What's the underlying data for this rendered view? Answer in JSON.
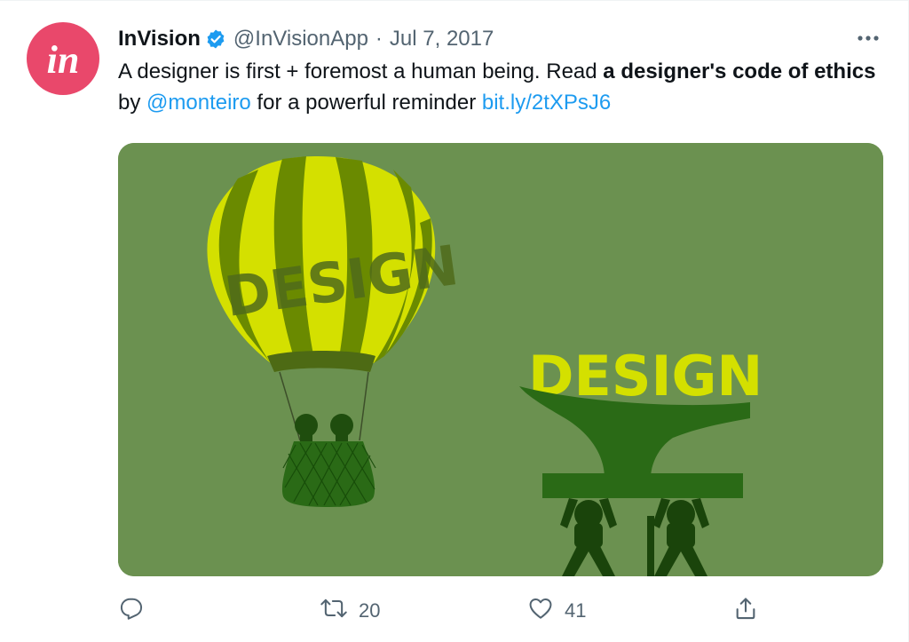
{
  "tweet": {
    "author": {
      "name": "InVision",
      "handle": "@InVisionApp",
      "separator": "·",
      "date": "Jul 7, 2017",
      "avatar_icon": "invision-logo",
      "avatar_text": "in",
      "verified_icon": "verified-badge-icon"
    },
    "text": {
      "part1": "A designer is first + foremost a human being. Read ",
      "bold": "a designer's code of ethics",
      "part2": " by ",
      "mention": "@monteiro",
      "part3": " for a powerful reminder ",
      "url": "bit.ly/2tXPsJ6"
    },
    "media": {
      "balloon_word": "DESIGN",
      "statue_word": "DESIGN"
    },
    "actions": {
      "reply_icon": "reply-icon",
      "retweet_icon": "retweet-icon",
      "retweet_count": "20",
      "like_icon": "heart-icon",
      "like_count": "41",
      "share_icon": "share-icon"
    },
    "more_icon": "more-options-icon"
  },
  "colors": {
    "avatar_bg": "#e9486b",
    "verified": "#1d9bf0",
    "link": "#1d9bf0",
    "secondary_text": "#536471",
    "media_bg": "#6b9150",
    "lime": "#d4e000",
    "olive": "#6a8a00",
    "dark_green": "#1f5a12"
  }
}
